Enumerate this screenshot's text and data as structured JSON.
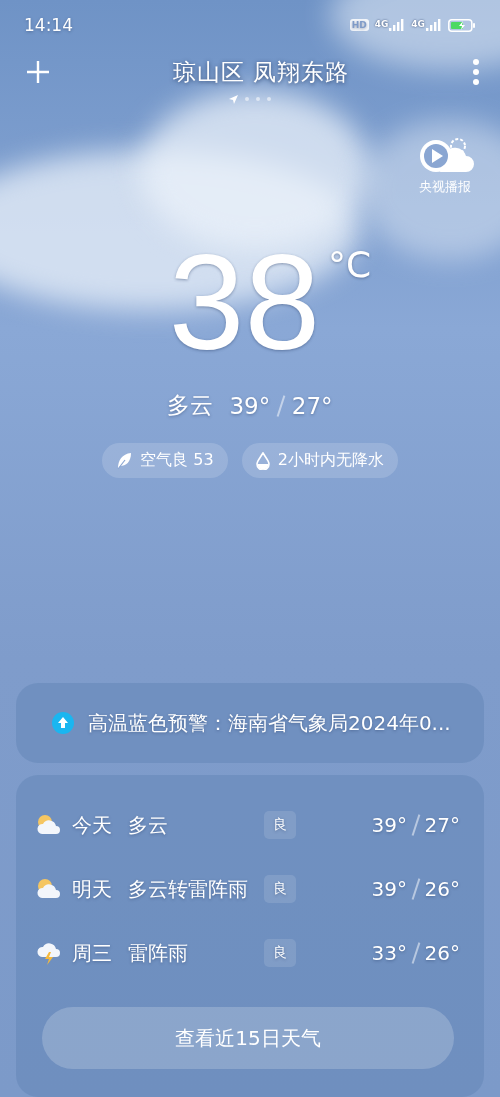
{
  "status_bar": {
    "time": "14:14",
    "hd": "HD",
    "network_1": "4G",
    "network_2": "4G"
  },
  "header": {
    "location": "琼山区 凤翔东路"
  },
  "page_indicator": [
    {
      "kind": "location",
      "selected": true
    },
    {
      "kind": "dot",
      "selected": false
    },
    {
      "kind": "dot",
      "selected": false
    },
    {
      "kind": "dot",
      "selected": false
    }
  ],
  "broadcast": {
    "label": "央视播报"
  },
  "current": {
    "temperature": "38",
    "unit": "°C",
    "condition": "多云",
    "high": "39°",
    "low": "27°"
  },
  "chips": [
    {
      "kind": "air",
      "label": "空气良 53"
    },
    {
      "kind": "rain",
      "label": "2小时内无降水"
    }
  ],
  "alert": {
    "text": "高温蓝色预警：海南省气象局2024年0..."
  },
  "forecast": [
    {
      "kind": "cloudy",
      "day": "今天",
      "condition": "多云",
      "aqi": "良",
      "high": "39°",
      "low": "27°"
    },
    {
      "kind": "cloudy",
      "day": "明天",
      "condition": "多云转雷阵雨",
      "aqi": "良",
      "high": "39°",
      "low": "26°"
    },
    {
      "kind": "thunder",
      "day": "周三",
      "condition": "雷阵雨",
      "aqi": "良",
      "high": "33°",
      "low": "26°"
    }
  ],
  "more_button": {
    "label": "查看近15日天气"
  }
}
